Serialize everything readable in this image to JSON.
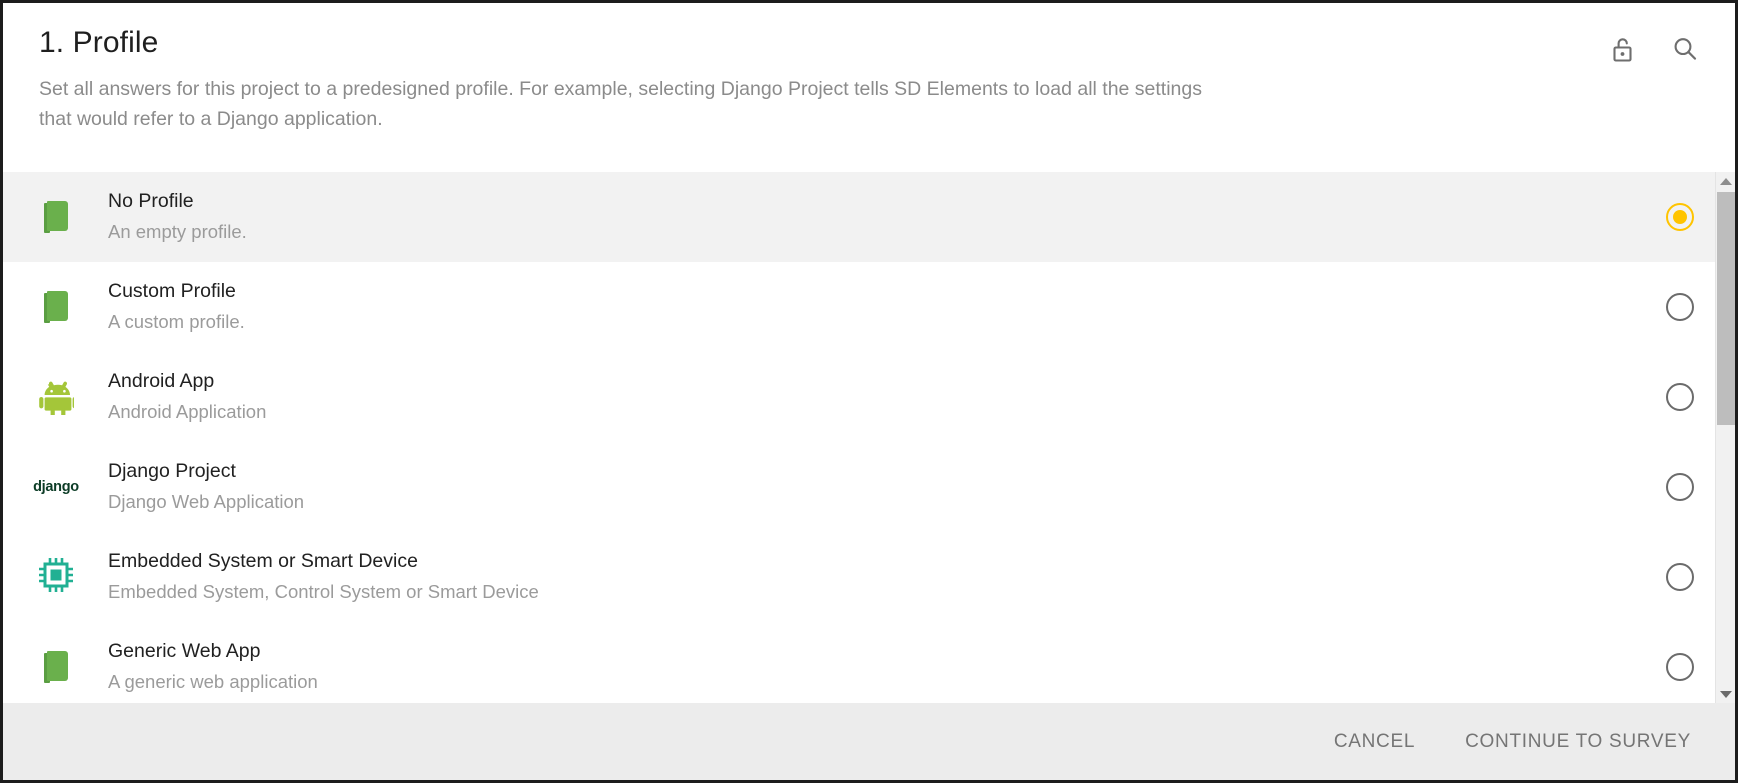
{
  "header": {
    "title": "1. Profile",
    "description": "Set all answers for this project to a predesigned profile. For example, selecting Django Project tells SD Elements to load all the settings that would refer to a Django application.",
    "actions": [
      {
        "name": "lock-icon",
        "label": "Unlock"
      },
      {
        "name": "search-icon",
        "label": "Search"
      }
    ]
  },
  "profiles": [
    {
      "title": "No Profile",
      "subtitle": "An empty profile.",
      "icon": "book-icon",
      "selected": true
    },
    {
      "title": "Custom Profile",
      "subtitle": "A custom profile.",
      "icon": "book-icon",
      "selected": false
    },
    {
      "title": "Android App",
      "subtitle": "Android Application",
      "icon": "android-icon",
      "selected": false
    },
    {
      "title": "Django Project",
      "subtitle": "Django Web Application",
      "icon": "django-icon",
      "icon_text": "django",
      "selected": false
    },
    {
      "title": "Embedded System or Smart Device",
      "subtitle": "Embedded System, Control System or Smart Device",
      "icon": "chip-icon",
      "selected": false
    },
    {
      "title": "Generic Web App",
      "subtitle": "A generic web application",
      "icon": "book-icon",
      "selected": false
    }
  ],
  "footer": {
    "cancel_label": "CANCEL",
    "continue_label": "CONTINUE TO SURVEY"
  },
  "colors": {
    "selected_radio": "#ffc400",
    "radio_outline": "#6b6b6b",
    "row_selected_bg": "#f2f2f2",
    "footer_bg": "#ececec",
    "book_green": "#6ab04c",
    "android_green": "#a4c639",
    "chip_teal": "#21b093",
    "django_green": "#0c3c26",
    "title_text": "#1f1f1f",
    "subtitle_text": "#9b9b9b"
  },
  "scrollbar": {
    "up_arrow": "scroll-up",
    "down_arrow": "scroll-down",
    "thumb": "scroll-thumb"
  }
}
